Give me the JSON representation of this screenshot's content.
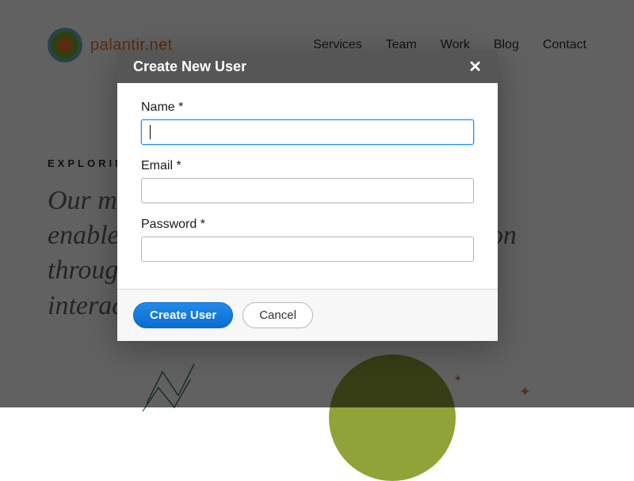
{
  "header": {
    "logo_text": "palantir.net",
    "nav": [
      "Services",
      "Team",
      "Work",
      "Blog",
      "Contact"
    ]
  },
  "hero": {
    "kicker": "EXPLORIN",
    "text": "Our m                                                   and enable                                                  mation throug                                                  interac"
  },
  "modal": {
    "title": "Create New User",
    "close_glyph": "✕",
    "fields": {
      "name": {
        "label": "Name *",
        "value": ""
      },
      "email": {
        "label": "Email *",
        "value": ""
      },
      "password": {
        "label": "Password *",
        "value": ""
      }
    },
    "actions": {
      "primary": "Create User",
      "secondary": "Cancel"
    }
  }
}
